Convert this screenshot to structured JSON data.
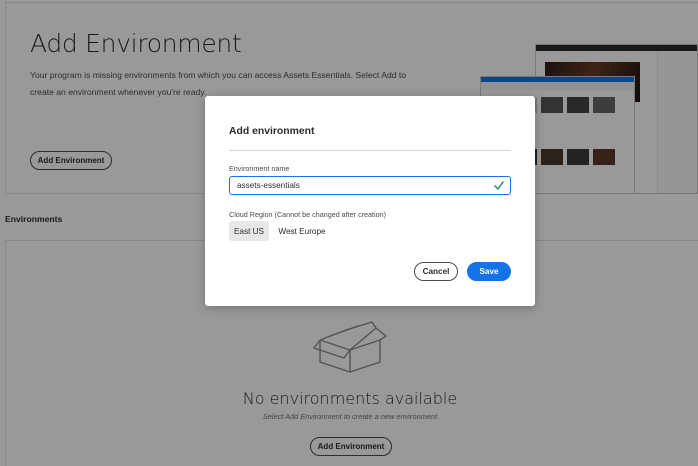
{
  "hero": {
    "title": "Add Environment",
    "description": "Your program is missing environments from which you can access Assets Essentials. Select Add to create an environment whenever you're ready.",
    "add_button": "Add Environment"
  },
  "environments": {
    "section_label": "Environments",
    "empty_title": "No environments available",
    "empty_subtitle": "Select Add Environment to create a new environment",
    "add_button": "Add Environment"
  },
  "dialog": {
    "title": "Add environment",
    "name_label": "Environment name",
    "name_value": "assets-essentials",
    "region_label": "Cloud Region (Cannot be changed after creation)",
    "regions": [
      "East US",
      "West Europe"
    ],
    "selected_region": "East US",
    "cancel_label": "Cancel",
    "save_label": "Save"
  },
  "icons": {
    "valid": "checkmark-icon",
    "empty_state": "open-box-icon"
  },
  "colors": {
    "accent": "#1473e6",
    "valid": "#2d9d78",
    "overlay": "rgba(0,0,0,0.40)"
  }
}
